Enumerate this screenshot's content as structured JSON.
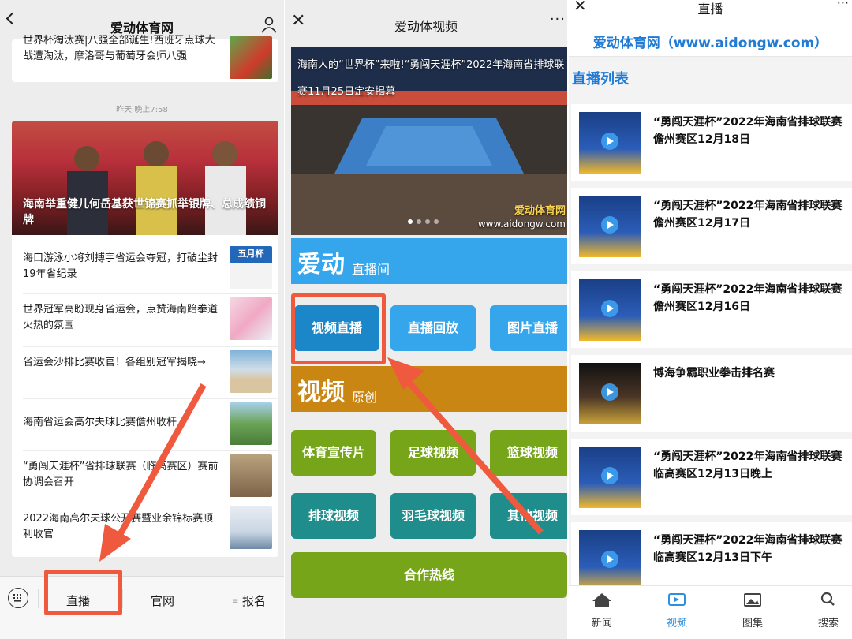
{
  "panel1": {
    "title": "爱动体育网",
    "top_item": "世界杯淘汰赛|八强全部诞生!西班牙点球大战遭淘汰，摩洛哥与葡萄牙会师八强",
    "timestamp": "昨天 晚上7:58",
    "hero_title": "海南举重健儿何岳基获世锦赛抓举银牌、总成绩铜牌",
    "articles": [
      "海口游泳小将刘搏宇省运会夺冠，打破尘封19年省纪录",
      "世界冠军高盼现身省运会，点赞海南跆拳道火热的氛围",
      "省运会沙排比赛收官！各组别冠军揭晓→",
      "海南省运会高尔夫球比赛儋州收杆",
      "“勇闯天涯杯”省排球联赛（临高赛区）赛前协调会召开",
      "2022海南高尔夫球公开赛暨业余锦标赛顺利收官"
    ],
    "thumb_label": "五月杯",
    "bottom_menu": [
      "直播",
      "官网",
      "报名"
    ]
  },
  "panel2": {
    "title": "爱动体视频",
    "more": "···",
    "banner_caption": "海南人的“世界杯”来啦!“勇闯天涯杯”2022年海南省排球联赛11月25日定安揭幕",
    "banner_logo": "爱动体育网",
    "banner_url": "www.aidongw.com",
    "section1_big": "爱动",
    "section1_small": "直播间",
    "live_buttons": [
      "视频直播",
      "直播回放",
      "图片直播"
    ],
    "section2_big": "视频",
    "section2_small": "原创",
    "video_buttons": [
      "体育宣传片",
      "足球视频",
      "篮球视频",
      "排球视频",
      "羽毛球视频",
      "其他视频"
    ],
    "hotline": "合作热线",
    "colors": {
      "blue": "#35a6ec",
      "orange": "#c98612",
      "green": "#76a51a",
      "teal": "#1e8d8b",
      "red_highlight": "#ef5a3e"
    }
  },
  "panel3": {
    "title": "直播",
    "more": "···",
    "site_name": "爱动体育网（www.aidongw.com）",
    "list_title": "直播列表",
    "items": [
      {
        "line1": "“勇闯天涯杯”2022年海南省排球联赛",
        "line2": "儋州赛区12月18日"
      },
      {
        "line1": "“勇闯天涯杯”2022年海南省排球联赛",
        "line2": "儋州赛区12月17日"
      },
      {
        "line1": "“勇闯天涯杯”2022年海南省排球联赛",
        "line2": "儋州赛区12月16日"
      },
      {
        "line1": "博海争霸职业拳击排名赛",
        "line2": ""
      },
      {
        "line1": "“勇闯天涯杯”2022年海南省排球联赛",
        "line2": "临高赛区12月13日晚上"
      },
      {
        "line1": "“勇闯天涯杯”2022年海南省排球联赛",
        "line2": "临高赛区12月13日下午"
      }
    ],
    "tabs": [
      "新闻",
      "视频",
      "图集",
      "搜索"
    ]
  }
}
